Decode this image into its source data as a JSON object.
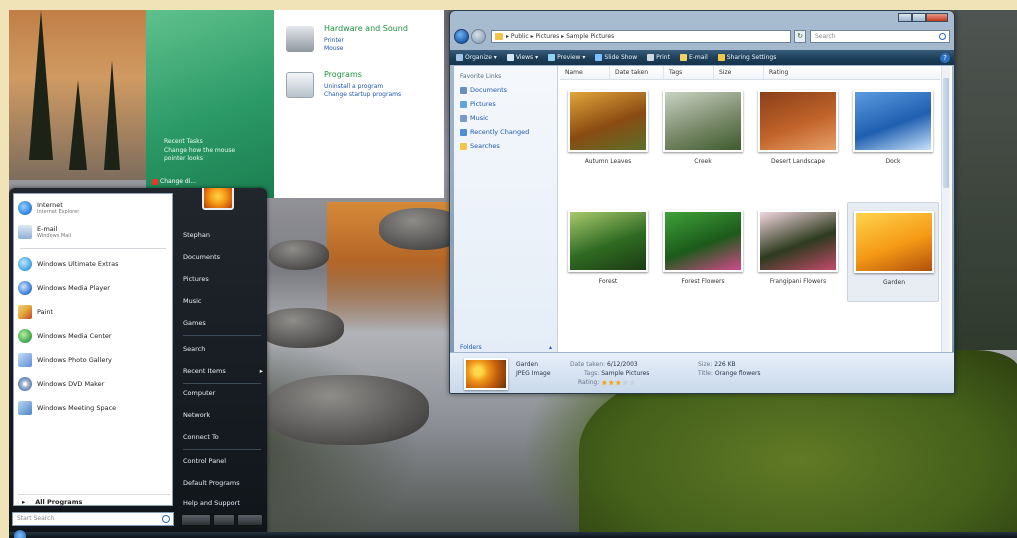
{
  "control_panel": {
    "recent_tasks_title": "Recent Tasks",
    "recent_tasks": [
      "Change how the mouse",
      "pointer looks"
    ],
    "change_link": "Change di...",
    "sections": [
      {
        "title": "Hardware and Sound",
        "links": [
          "Printer",
          "Mouse"
        ],
        "icon": "printer-icon"
      },
      {
        "title": "Programs",
        "links": [
          "Uninstall a program",
          "Change startup programs"
        ],
        "icon": "programs-icon"
      }
    ]
  },
  "start_menu": {
    "pinned": [
      {
        "label": "Internet",
        "sub": "Internet Explorer",
        "icon": "internet-explorer-icon",
        "color": "#2c7fd6"
      },
      {
        "label": "E-mail",
        "sub": "Windows Mail",
        "icon": "mail-icon",
        "color": "#3b88c9"
      }
    ],
    "programs": [
      {
        "label": "Windows Ultimate Extras",
        "icon": "extras-icon",
        "color": "#3aa0e0"
      },
      {
        "label": "Windows Media Player",
        "icon": "media-player-icon",
        "color": "#2f77d0"
      },
      {
        "label": "Paint",
        "icon": "paint-icon",
        "color": "#e0a63a"
      },
      {
        "label": "Windows Media Center",
        "icon": "media-center-icon",
        "color": "#39a34a"
      },
      {
        "label": "Windows Photo Gallery",
        "icon": "photo-gallery-icon",
        "color": "#5c8ed8"
      },
      {
        "label": "Windows DVD Maker",
        "icon": "dvd-maker-icon",
        "color": "#5d7fb8"
      },
      {
        "label": "Windows Meeting Space",
        "icon": "meeting-space-icon",
        "color": "#4a86c8"
      }
    ],
    "all_programs": "All Programs",
    "search_placeholder": "Start Search",
    "right_items": [
      {
        "label": "Stephan",
        "arrow": ""
      },
      {
        "label": "Documents",
        "arrow": ""
      },
      {
        "label": "Pictures",
        "arrow": ""
      },
      {
        "label": "Music",
        "arrow": ""
      },
      {
        "label": "Games",
        "arrow": ""
      },
      {
        "label": "Search",
        "arrow": ""
      },
      {
        "label": "Recent Items",
        "arrow": "▸"
      },
      {
        "label": "Computer",
        "arrow": ""
      },
      {
        "label": "Network",
        "arrow": ""
      },
      {
        "label": "Connect To",
        "arrow": ""
      },
      {
        "label": "Control Panel",
        "arrow": ""
      },
      {
        "label": "Default Programs",
        "arrow": ""
      },
      {
        "label": "Help and Support",
        "arrow": ""
      }
    ]
  },
  "explorer": {
    "address": "▸ Public ▸ Pictures ▸ Sample Pictures",
    "search_placeholder": "Search",
    "toolbar": [
      {
        "label": "Organize ▾",
        "icon": "organize-icon",
        "color": "#9fc4ea"
      },
      {
        "label": "Views ▾",
        "icon": "views-icon",
        "color": "#d6e5f3"
      },
      {
        "label": "Preview ▾",
        "icon": "preview-icon",
        "color": "#8fd3f0"
      },
      {
        "label": "Slide Show",
        "icon": "slideshow-icon",
        "color": "#7ec0ff"
      },
      {
        "label": "Print",
        "icon": "print-icon",
        "color": "#cfd9e4"
      },
      {
        "label": "E-mail",
        "icon": "email-icon",
        "color": "#f2d264"
      },
      {
        "label": "Sharing Settings",
        "icon": "sharing-icon",
        "color": "#f4c64a"
      }
    ],
    "favorite_links_title": "Favorite Links",
    "favorite_links": [
      {
        "label": "Documents",
        "color": "#6b8fbf"
      },
      {
        "label": "Pictures",
        "color": "#5fa3d9"
      },
      {
        "label": "Music",
        "color": "#7b9acb"
      },
      {
        "label": "Recently Changed",
        "color": "#4f8fd4"
      },
      {
        "label": "Searches",
        "color": "#f3c54a"
      }
    ],
    "folders_label": "Folders",
    "columns": [
      "Name",
      "Date taken",
      "Tags",
      "Size",
      "Rating"
    ],
    "items": [
      {
        "name": "Autumn Leaves",
        "colors": [
          "#8a4b12",
          "#e2a63a",
          "#5d6f2a"
        ]
      },
      {
        "name": "Creek",
        "colors": [
          "#7a8a6a",
          "#c9d3c4",
          "#3e5b2e"
        ]
      },
      {
        "name": "Desert Landscape",
        "colors": [
          "#c0632a",
          "#8a3f1a",
          "#e9a06a"
        ]
      },
      {
        "name": "Dock",
        "colors": [
          "#1f5fb0",
          "#5c9be0",
          "#c9e2fb"
        ]
      },
      {
        "name": "Forest",
        "colors": [
          "#2f6a22",
          "#a8c96d",
          "#1b3c14"
        ]
      },
      {
        "name": "Forest Flowers",
        "colors": [
          "#1c5a1a",
          "#3fa13a",
          "#d04a8a"
        ]
      },
      {
        "name": "Frangipani Flowers",
        "colors": [
          "#2d3b1e",
          "#f2d7df",
          "#c24a6a"
        ]
      },
      {
        "name": "Garden",
        "colors": [
          "#f59a15",
          "#ffd34d",
          "#b1500d"
        ]
      }
    ],
    "selected_item": "Garden",
    "details": {
      "name": "Garden",
      "type": "JPEG Image",
      "date_label": "Date taken:",
      "date": "6/12/2003",
      "tags_label": "Tags:",
      "tags": "Sample Pictures",
      "rating_label": "Rating:",
      "rating": 3,
      "size_label": "Size:",
      "size": "226 KB",
      "title_label": "Title:",
      "title": "Orange flowers"
    }
  }
}
